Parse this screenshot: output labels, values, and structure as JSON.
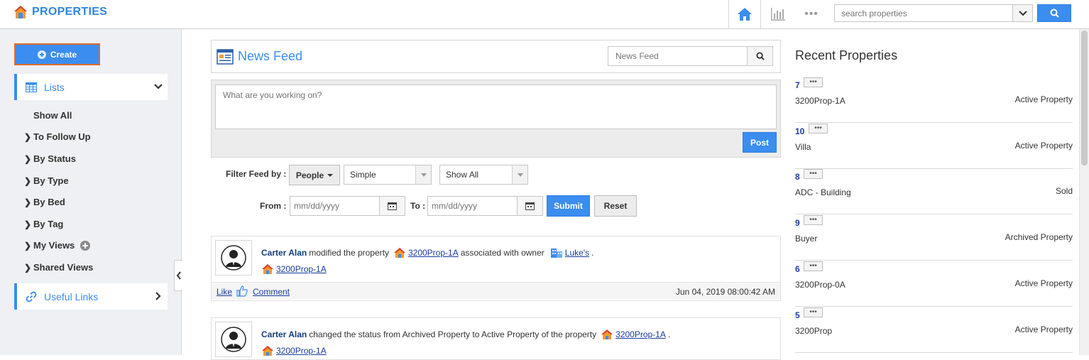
{
  "app": {
    "title": "PROPERTIES"
  },
  "topbar": {
    "search_placeholder": "search properties",
    "icons": [
      "home-icon",
      "chart-icon",
      "more-icon",
      "chevron-down-icon",
      "search-icon"
    ]
  },
  "sidebar": {
    "create_label": "Create",
    "lists_label": "Lists",
    "items": [
      {
        "label": "Show All",
        "expandable": false
      },
      {
        "label": "To Follow Up",
        "expandable": true
      },
      {
        "label": "By Status",
        "expandable": true
      },
      {
        "label": "By Type",
        "expandable": true
      },
      {
        "label": "By Bed",
        "expandable": true
      },
      {
        "label": "By Tag",
        "expandable": true
      },
      {
        "label": "My Views",
        "expandable": true
      },
      {
        "label": "Shared Views",
        "expandable": true
      }
    ],
    "useful_links_label": "Useful Links"
  },
  "feed": {
    "title": "News Feed",
    "search_placeholder": "News Feed",
    "post_placeholder": "What are you working on?",
    "post_button": "Post",
    "filter_label": "Filter Feed by :",
    "people_button": "People",
    "select1": "Simple",
    "select2": "Show All",
    "from_label": "From :",
    "to_label": "To :",
    "date_placeholder": "mm/dd/yyyy",
    "submit_button": "Submit",
    "reset_button": "Reset",
    "items": [
      {
        "actor": "Carter Alan",
        "text1": "modified the property",
        "link1": "3200Prop-1A",
        "text2": "associated with owner",
        "link2": "Luke's",
        "text3": ".",
        "sub_link": "3200Prop-1A",
        "like": "Like",
        "comment": "Comment",
        "timestamp": "Jun 04, 2019 08:00:42 AM"
      },
      {
        "actor": "Carter Alan",
        "text1": "changed the status from Archived Property to Active Property of the property",
        "link1": "3200Prop-1A",
        "text3": ".",
        "sub_link": "3200Prop-1A"
      }
    ]
  },
  "recent": {
    "title": "Recent Properties",
    "items": [
      {
        "id": "7",
        "name": "3200Prop-1A",
        "status": "Active Property"
      },
      {
        "id": "10",
        "name": "Villa",
        "status": "Active Property"
      },
      {
        "id": "8",
        "name": "ADC - Building",
        "status": "Sold"
      },
      {
        "id": "9",
        "name": "Buyer",
        "status": "Archived Property"
      },
      {
        "id": "6",
        "name": "3200Prop-0A",
        "status": "Active Property"
      },
      {
        "id": "5",
        "name": "3200Prop",
        "status": "Active Property"
      }
    ],
    "more_glyph": "•••"
  },
  "colors": {
    "accent": "#3b8def",
    "link": "#1a3c9e",
    "create_border": "#e06a2b"
  }
}
